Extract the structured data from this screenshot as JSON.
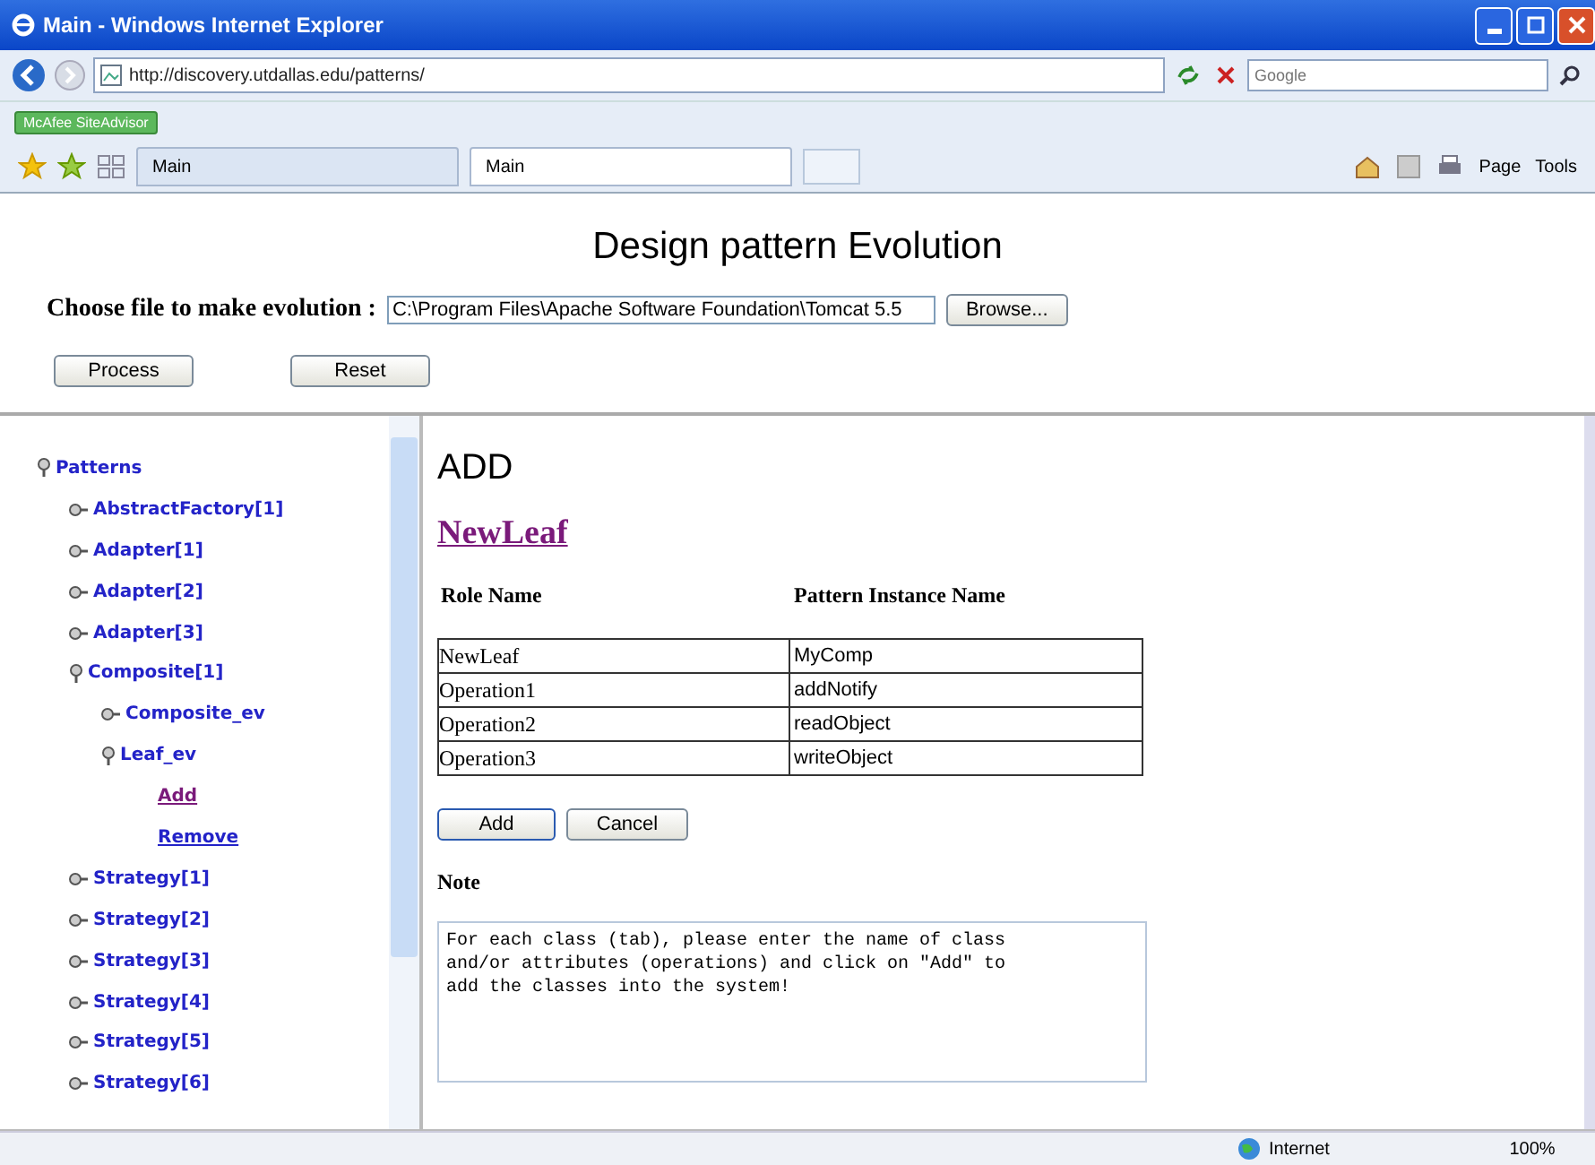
{
  "window": {
    "title": "Main - Windows Internet Explorer"
  },
  "address_bar": {
    "url": "http://discovery.utdallas.edu/patterns/",
    "search_placeholder": "Google"
  },
  "links_bar": {
    "addon": "McAfee SiteAdvisor"
  },
  "tabs": [
    {
      "label": "Main",
      "selected": false
    },
    {
      "label": "Main",
      "selected": true
    }
  ],
  "command_bar": [
    "Page",
    "Tools"
  ],
  "page": {
    "title": "Design pattern Evolution",
    "file_label": "Choose file to make evolution :",
    "file_value": "C:\\Program Files\\Apache Software Foundation\\Tomcat 5.5",
    "browse": "Browse...",
    "buttons": [
      "Process",
      "Reset"
    ]
  },
  "tree": [
    {
      "label": "Patterns",
      "expanded": true,
      "children": [
        {
          "label": "AbstractFactory[1]",
          "expanded": false
        },
        {
          "label": "Adapter[1]",
          "expanded": false
        },
        {
          "label": "Adapter[2]",
          "expanded": false
        },
        {
          "label": "Adapter[3]",
          "expanded": false
        },
        {
          "label": "Composite[1]",
          "expanded": true,
          "children": [
            {
              "label": "Composite_ev",
              "expanded": false
            },
            {
              "label": "Leaf_ev",
              "expanded": true,
              "children": [
                {
                  "label": "Add",
                  "kind": "link",
                  "selected": true
                },
                {
                  "label": "Remove",
                  "kind": "link",
                  "selected": false
                }
              ]
            }
          ]
        },
        {
          "label": "Strategy[1]",
          "expanded": false
        },
        {
          "label": "Strategy[2]",
          "expanded": false
        },
        {
          "label": "Strategy[3]",
          "expanded": false
        },
        {
          "label": "Strategy[4]",
          "expanded": false
        },
        {
          "label": "Strategy[5]",
          "expanded": false
        },
        {
          "label": "Strategy[6]",
          "expanded": false
        }
      ]
    }
  ],
  "content": {
    "heading": "ADD",
    "link": "NewLeaf",
    "columns": [
      "Role Name",
      "Pattern Instance Name"
    ],
    "rows": [
      [
        "NewLeaf",
        "MyComp"
      ],
      [
        "Operation1",
        "addNotify"
      ],
      [
        "Operation2",
        "readObject"
      ],
      [
        "Operation3",
        "writeObject"
      ]
    ],
    "buttons": [
      "Add",
      "Cancel"
    ],
    "note_label": "Note",
    "note_text": "For each class (tab), please enter the name of class and/or attributes (operations) and click on \"Add\" to add the classes into the system!"
  },
  "status_bar": {
    "zone": "Internet",
    "zoom": "100%"
  }
}
